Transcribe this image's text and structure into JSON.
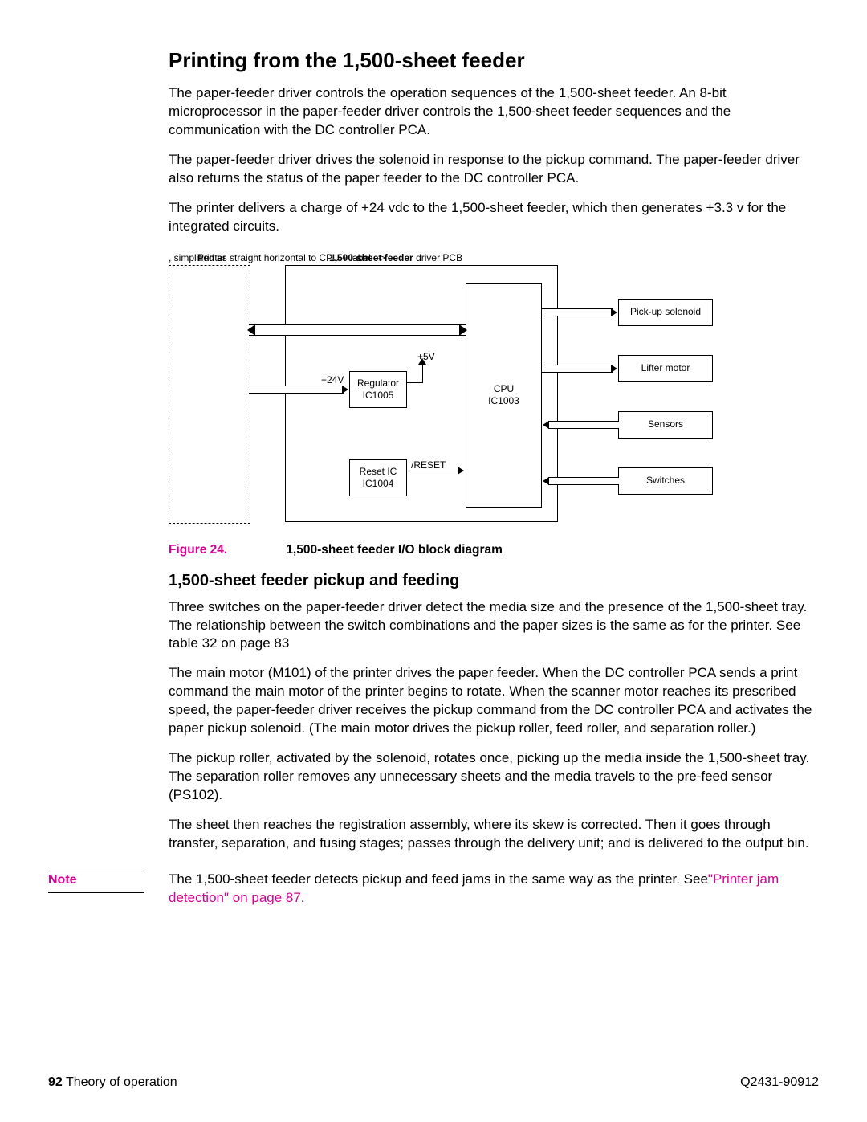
{
  "title": "Printing from the 1,500-sheet feeder",
  "p1": "The paper-feeder driver controls the operation sequences of the 1,500-sheet feeder. An 8-bit microprocessor in the paper-feeder driver controls the 1,500-sheet feeder sequences and the communication with the DC controller PCA.",
  "p2": "The paper-feeder driver drives the solenoid in response to the pickup command. The paper-feeder driver also returns the status of the paper feeder to the DC controller PCA.",
  "p3": "The printer delivers a charge of +24 vdc to the 1,500-sheet feeder, which then generates +3.3 v for the integrated circuits.",
  "figure": {
    "label": "Figure 24.",
    "title": "1,500-sheet feeder I/O block diagram"
  },
  "diagram": {
    "printer_label": "Printer",
    "pcb_label_bold": "1,500-sheet feeder",
    "pcb_label_rest": " driver PCB",
    "plus24v": "+24V",
    "plus5v": "+5V",
    "regulator": "Regulator\nIC1005",
    "resetic": "Reset IC\nIC1004",
    "reset_sig": "/RESET",
    "cpu": "CPU\nIC1003",
    "right": {
      "pickup": "Pick-up solenoid",
      "lifter": "Lifter motor",
      "sensors": "Sensors",
      "switches": "Switches"
    }
  },
  "h2": "1,500-sheet feeder pickup and feeding",
  "p4": "Three switches on the paper-feeder driver detect the media size and the presence of the 1,500-sheet tray. The relationship between the switch combinations and the paper sizes is the same as for the printer. See table 32 on page 83",
  "p5": "The main motor (M101) of the printer drives the paper feeder. When the DC controller PCA sends a print command the main motor of the printer begins to rotate. When the scanner motor reaches its prescribed speed, the paper-feeder driver receives the pickup command from the DC controller PCA and activates the paper pickup solenoid. (The main motor drives the pickup roller, feed roller, and separation roller.)",
  "p6": "The pickup roller, activated by the solenoid, rotates once, picking up the media inside the 1,500-sheet tray. The separation roller removes any unnecessary sheets and the media travels to the pre-feed sensor (PS102).",
  "p7": "The sheet then reaches the registration assembly, where its skew is corrected. Then it goes through transfer, separation, and fusing stages; passes through the delivery unit; and is delivered to the output bin.",
  "note": {
    "label": "Note",
    "text_before": "The 1,500-sheet feeder detects pickup and feed jams in the same way as the printer. See",
    "link": "\"Printer jam detection\" on page 87",
    "text_after": "."
  },
  "footer": {
    "page": "92",
    "chapter": " Theory of operation",
    "docnum": "Q2431-90912"
  }
}
